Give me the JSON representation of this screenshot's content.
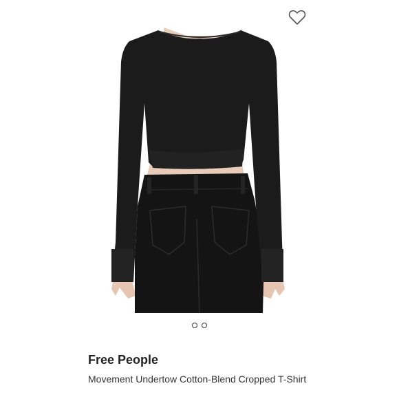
{
  "product": {
    "brand": "Free People",
    "name": "Movement Undertow Cotton-Blend Cropped T-Shirt",
    "favorite_icon": "heart-outline-icon"
  },
  "gallery": {
    "image_count": 2,
    "active_index": 0
  },
  "colors": {
    "garment": "#1b1b1b",
    "skin": "#e8cbb8",
    "background": "#ffffff",
    "text": "#222222"
  }
}
